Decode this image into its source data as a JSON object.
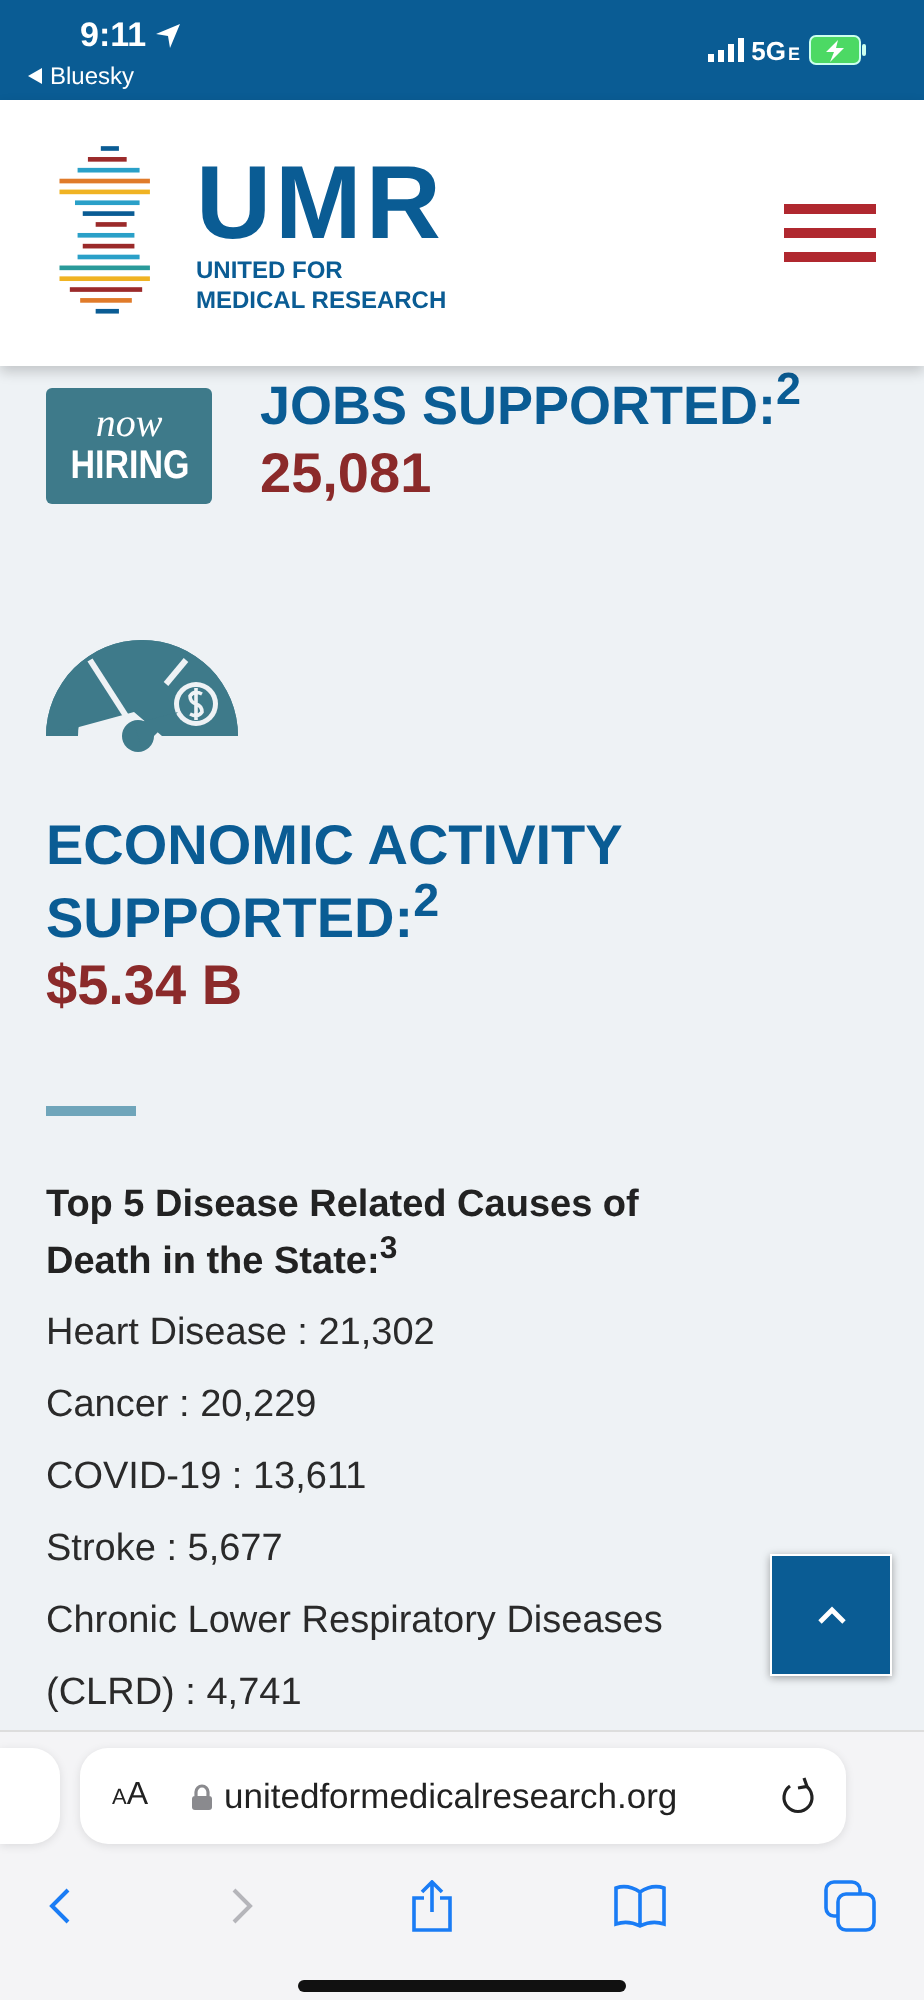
{
  "status_bar": {
    "time": "9:11",
    "back_app": "Bluesky",
    "network": "5G",
    "network_suffix": "E"
  },
  "header": {
    "logo_title": "UMR",
    "logo_subtitle": [
      "UNITED FOR",
      "MEDICAL RESEARCH"
    ]
  },
  "stats": [
    {
      "kind": "jobs",
      "badge": [
        "now",
        "HIRING"
      ],
      "title": "JOBS SUPPORTED:$^{2}$",
      "value": "25,081"
    },
    {
      "kind": "economy",
      "title": "ECONOMIC ACTIVITY SUPPORTED:$^{2}$",
      "value": "$5.34 B"
    }
  ],
  "causes": {
    "heading": "Top 5 Disease Related Causes of Death in the State:$^{3}$",
    "items": [
      "Heart Disease : 21,302",
      "Cancer : 20,229",
      "COVID-19 : 13,611",
      "Stroke : 5,677",
      "Chronic Lower Respiratory Diseases (CLRD) : 4,741"
    ]
  },
  "browser": {
    "text_size_small": "A",
    "text_size_large": "A",
    "url": "unitedformedicalresearch.org",
    "forward_disabled": true
  }
}
